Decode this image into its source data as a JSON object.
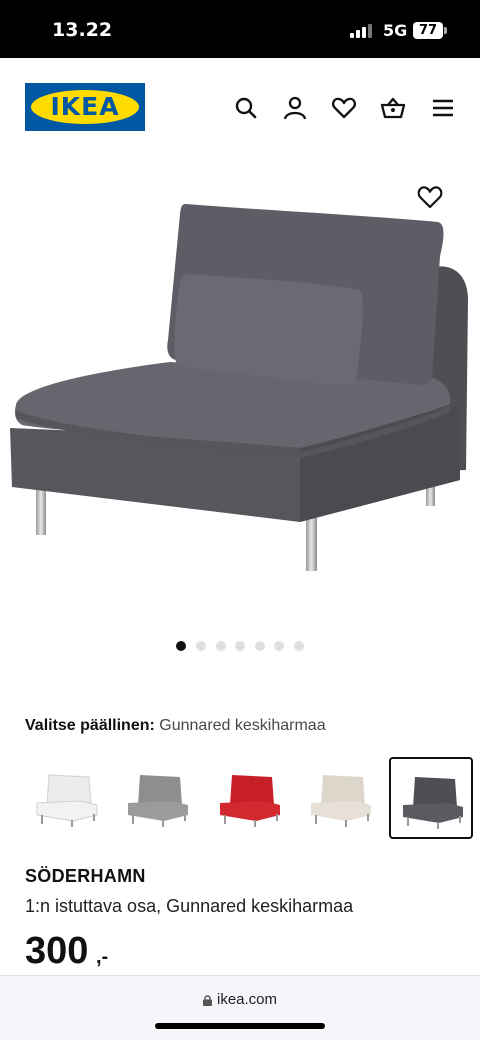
{
  "status_bar": {
    "time": "13.22",
    "network": "5G",
    "battery": "77"
  },
  "header": {
    "logo_text": "IKEA",
    "icons": [
      "search-icon",
      "user-icon",
      "heart-icon",
      "basket-icon",
      "menu-icon"
    ]
  },
  "gallery": {
    "image_count": 7,
    "active_index": 0
  },
  "cover": {
    "label": "Valitse päällinen:",
    "selected_value": "Gunnared keskiharmaa",
    "swatches": [
      {
        "color": "#ececec"
      },
      {
        "color": "#8e8e8e"
      },
      {
        "color": "#cc2128"
      },
      {
        "color": "#ddd6cb"
      },
      {
        "color": "#4d4f55",
        "selected": true
      }
    ]
  },
  "product": {
    "name": "SÖDERHAMN",
    "description": "1:n istuttava osa, Gunnared keskiharmaa",
    "price": "300",
    "price_suffix": ",-"
  },
  "browser": {
    "url": "ikea.com"
  }
}
